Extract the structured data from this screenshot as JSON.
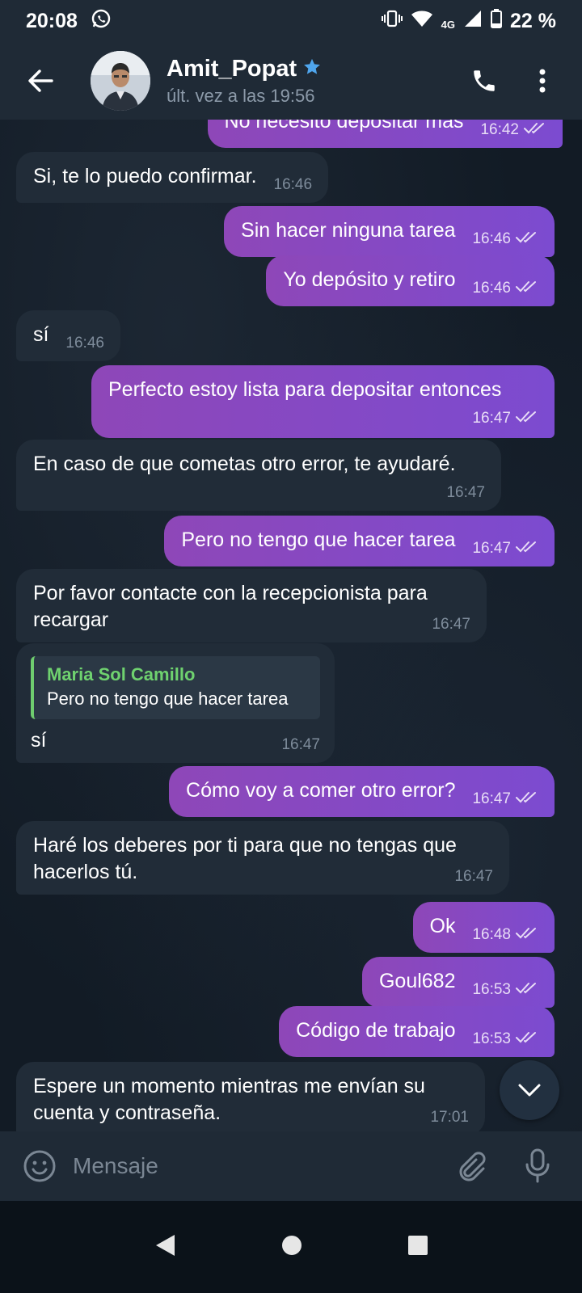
{
  "status_bar": {
    "time": "20:08",
    "network": "4G",
    "battery": "22 %"
  },
  "header": {
    "contact_name": "Amit_Popat",
    "last_seen": "últ. vez a las 19:56"
  },
  "messages": [
    {
      "dir": "out",
      "text": "No necesito depositar más",
      "time": "16:42"
    },
    {
      "dir": "in",
      "text": "Si, te lo puedo confirmar.",
      "time": "16:46"
    },
    {
      "dir": "out",
      "text": "Sin hacer ninguna tarea",
      "time": "16:46"
    },
    {
      "dir": "out",
      "text": "Yo depósito y retiro",
      "time": "16:46"
    },
    {
      "dir": "in",
      "text": "sí",
      "time": "16:46"
    },
    {
      "dir": "out",
      "text": "Perfecto estoy lista para depositar entonces",
      "time": "16:47"
    },
    {
      "dir": "in",
      "text": "En caso de que cometas otro error, te ayudaré.",
      "time": "16:47"
    },
    {
      "dir": "out",
      "text": "Pero no tengo que hacer tarea",
      "time": "16:47"
    },
    {
      "dir": "in",
      "text": "Por favor contacte con la recepcionista para recargar",
      "time": "16:47"
    },
    {
      "dir": "in",
      "text": "sí",
      "time": "16:47",
      "reply": {
        "name": "Maria Sol Camillo",
        "text": "Pero no tengo que hacer tarea"
      }
    },
    {
      "dir": "out",
      "text": "Cómo voy a comer otro error?",
      "time": "16:47"
    },
    {
      "dir": "in",
      "text": "Haré los deberes por ti para que no tengas que hacerlos tú.",
      "time": "16:47"
    },
    {
      "dir": "out",
      "text": "Ok",
      "time": "16:48"
    },
    {
      "dir": "out",
      "text": "Goul682",
      "time": "16:53"
    },
    {
      "dir": "out",
      "text": "Código de trabajo",
      "time": "16:53"
    },
    {
      "dir": "in",
      "text": "Espere un momento mientras me envían su cuenta y contraseña.",
      "time": "17:01"
    }
  ],
  "composer": {
    "placeholder": "Mensaje"
  },
  "colors": {
    "accent_out": "#8e47b8",
    "bubble_in": "#212c38",
    "header_bg": "#1f2a36",
    "reply_name": "#6fd26f"
  }
}
